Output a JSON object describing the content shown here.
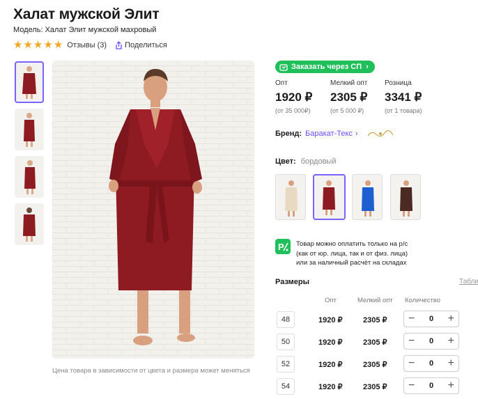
{
  "product": {
    "title": "Халат мужской Элит",
    "model": "Модель: Халат Элит мужской махровый",
    "stars": 5,
    "reviews": "Отзывы (3)",
    "share": "Поделиться"
  },
  "gallery": {
    "thumbnails": [
      "thumb-front",
      "thumb-side",
      "thumb-side-2",
      "thumb-back"
    ],
    "caption": "Цена товара в зависимости от цвета и размера может меняться"
  },
  "order_button": "Заказать через СП",
  "prices": [
    {
      "label": "Опт",
      "value": "1920 ₽",
      "note": "(от 35 000₽)"
    },
    {
      "label": "Мелкий опт",
      "value": "2305 ₽",
      "note": "(от 5 000 ₽)"
    },
    {
      "label": "Розница",
      "value": "3341 ₽",
      "note": "(от 1 товара)"
    }
  ],
  "brand": {
    "label": "Бренд:",
    "value": "Баракат-Текс"
  },
  "color": {
    "label": "Цвет:",
    "value": "бордовый",
    "swatches": [
      {
        "name": "beige",
        "hex": "#e8d9c3"
      },
      {
        "name": "bordeaux",
        "hex": "#8e1a22"
      },
      {
        "name": "blue",
        "hex": "#1d5fd1"
      },
      {
        "name": "brown",
        "hex": "#4a2a22"
      }
    ]
  },
  "payment_note": [
    "Товар можно оплатить только на р/с",
    "(как от юр. лица, так и от физ. лица)",
    "или за наличный расчёт на складах"
  ],
  "sizes": {
    "title": "Размеры",
    "table_link": "Таблиц",
    "headers": [
      "Опт",
      "Мелкий опт",
      "Количество"
    ],
    "rows": [
      {
        "size": "48",
        "opt": "1920 ₽",
        "small": "2305 ₽",
        "qty": "0"
      },
      {
        "size": "50",
        "opt": "1920 ₽",
        "small": "2305 ₽",
        "qty": "0"
      },
      {
        "size": "52",
        "opt": "1920 ₽",
        "small": "2305 ₽",
        "qty": "0"
      },
      {
        "size": "54",
        "opt": "1920 ₽",
        "small": "2305 ₽",
        "qty": "0"
      }
    ]
  },
  "colors": {
    "accent": "#7b61ff",
    "green": "#1fbf5a",
    "star": "#f5a623",
    "robe": "#8e1a22"
  }
}
